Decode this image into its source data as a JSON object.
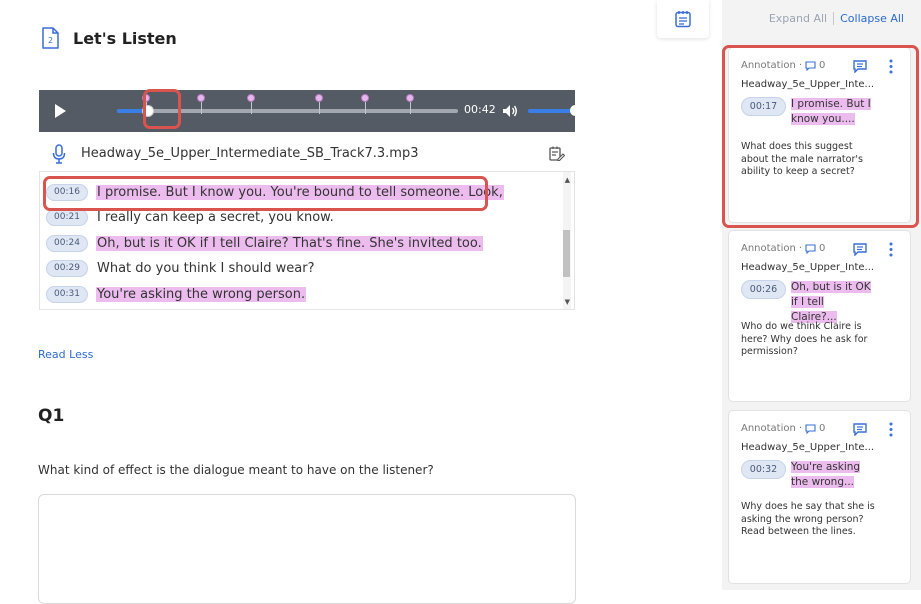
{
  "page": {
    "title": "Let's Listen",
    "doc_icon_number": "2"
  },
  "player": {
    "time": "00:42",
    "progress_fraction": 0.09,
    "volume_fraction": 0.95,
    "file_name": "Headway_5e_Upper_Intermediate_SB_Track7.3.mp3",
    "accent_color": "#3a7ee8"
  },
  "transcript": {
    "lines": [
      {
        "ts": "00:16",
        "text": "I promise. But I know you. You're bound to tell someone. Look,",
        "highlight": true
      },
      {
        "ts": "00:21",
        "text": "I really can keep a secret, you know.",
        "highlight": false
      },
      {
        "ts": "00:24",
        "text": "Oh, but is it OK if I tell Claire? That's fine. She's invited too.",
        "highlight": true
      },
      {
        "ts": "00:29",
        "text": "What do you think I should wear?",
        "highlight": false
      },
      {
        "ts": "00:31",
        "text": "You're asking the wrong person.",
        "highlight": true
      }
    ]
  },
  "read_less": "Read Less",
  "question": {
    "label": "Q1",
    "text": "What kind of effect is the dialogue meant to have on the listener?"
  },
  "sidebar": {
    "expand_all": "Expand All",
    "collapse_all": "Collapse All",
    "cards": [
      {
        "type": "Annotation",
        "comment_count": "0",
        "file": "Headway_5e_Upper_Inte...",
        "ts": "00:17",
        "quote_line1": "I promise. But I",
        "quote_line2": "know you....",
        "text": "What does this suggest about the male narrator's ability to keep a secret?"
      },
      {
        "type": "Annotation",
        "comment_count": "0",
        "file": "Headway_5e_Upper_Inte...",
        "ts": "00:26",
        "quote_line1": "Oh, but is it OK",
        "quote_line2": "if I tell Claire?...",
        "text": "Who do we think Claire is here? Why does he ask for permission?"
      },
      {
        "type": "Annotation",
        "comment_count": "0",
        "file": "Headway_5e_Upper_Inte...",
        "ts": "00:32",
        "quote_line1": "You're asking",
        "quote_line2": "the wrong...",
        "text": "Why does he say that she is asking the wrong person? Read between the lines."
      }
    ]
  },
  "colors": {
    "highlight": "#edbcef",
    "callout_border": "#d9534f",
    "link": "#2a6bd1"
  }
}
